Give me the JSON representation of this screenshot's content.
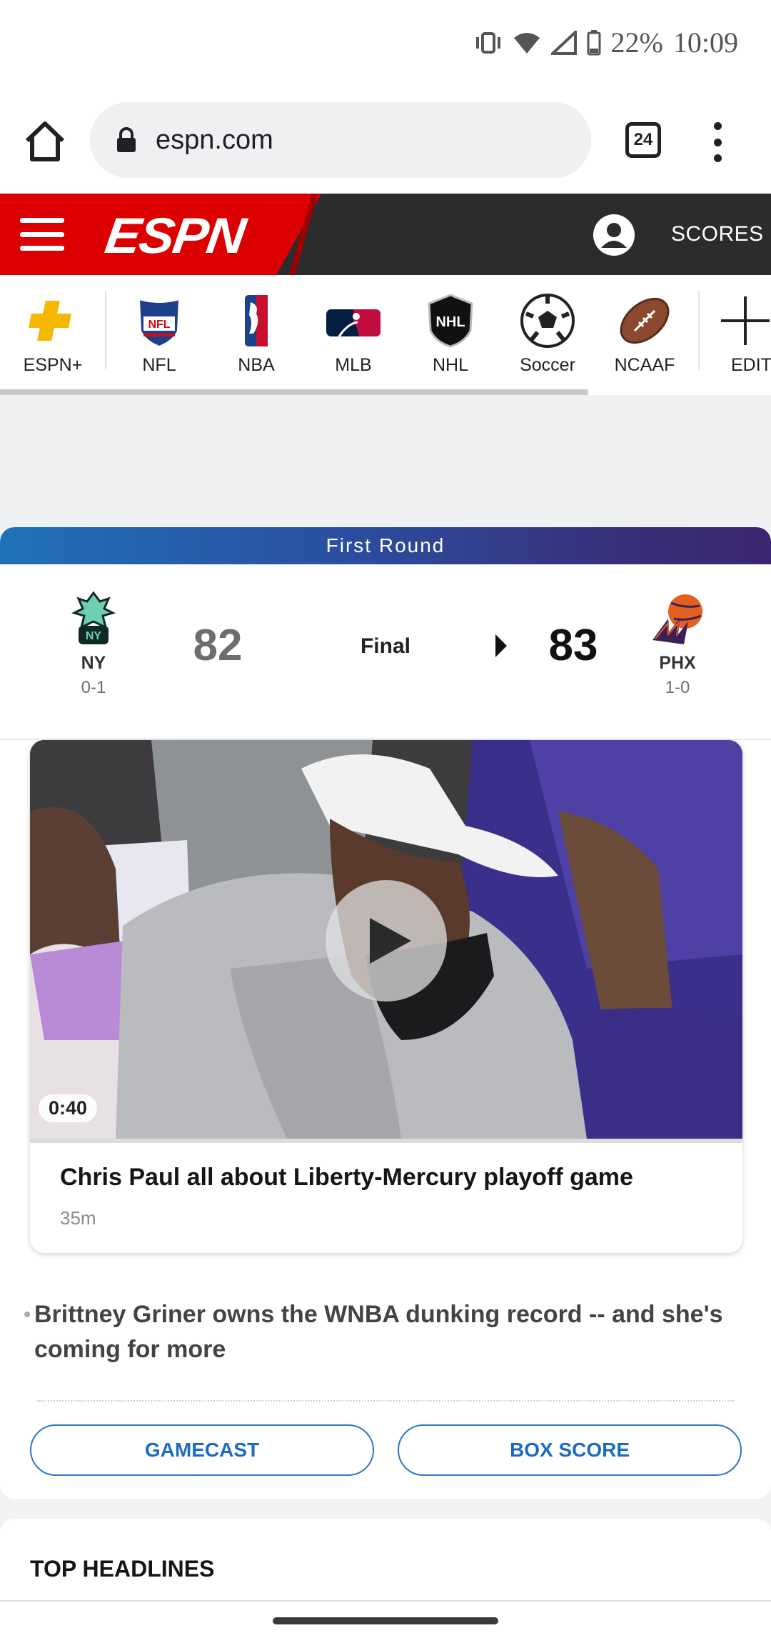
{
  "status_bar": {
    "battery": "22%",
    "time": "10:09"
  },
  "browser": {
    "url": "espn.com",
    "tab_count": "24"
  },
  "header": {
    "logo_text": "ESPN",
    "scores_label": "SCORES"
  },
  "sports_nav": {
    "items": [
      {
        "label": "ESPN+",
        "icon": "espn-plus-icon"
      },
      {
        "label": "NFL",
        "icon": "nfl-icon"
      },
      {
        "label": "NBA",
        "icon": "nba-icon"
      },
      {
        "label": "MLB",
        "icon": "mlb-icon"
      },
      {
        "label": "NHL",
        "icon": "nhl-icon"
      },
      {
        "label": "Soccer",
        "icon": "soccer-ball-icon"
      },
      {
        "label": "NCAAF",
        "icon": "football-icon"
      },
      {
        "label": "EDIT",
        "icon": "plus-icon"
      }
    ]
  },
  "game": {
    "round": "First Round",
    "status": "Final",
    "away": {
      "abbr": "NY",
      "record": "0-1",
      "score": "82"
    },
    "home": {
      "abbr": "PHX",
      "record": "1-0",
      "score": "83"
    }
  },
  "video": {
    "duration": "0:40",
    "title": "Chris Paul all about Liberty-Mercury playoff game",
    "age": "35m"
  },
  "story": {
    "headline": "Brittney Griner owns the WNBA dunking record -- and she's coming for more"
  },
  "buttons": {
    "gamecast": "GAMECAST",
    "box_score": "BOX SCORE"
  },
  "top_headlines": {
    "title": "TOP HEADLINES"
  },
  "colors": {
    "espn_red": "#dd0000",
    "header_dark": "#2b2c2d",
    "link_blue": "#1b6cc0"
  }
}
